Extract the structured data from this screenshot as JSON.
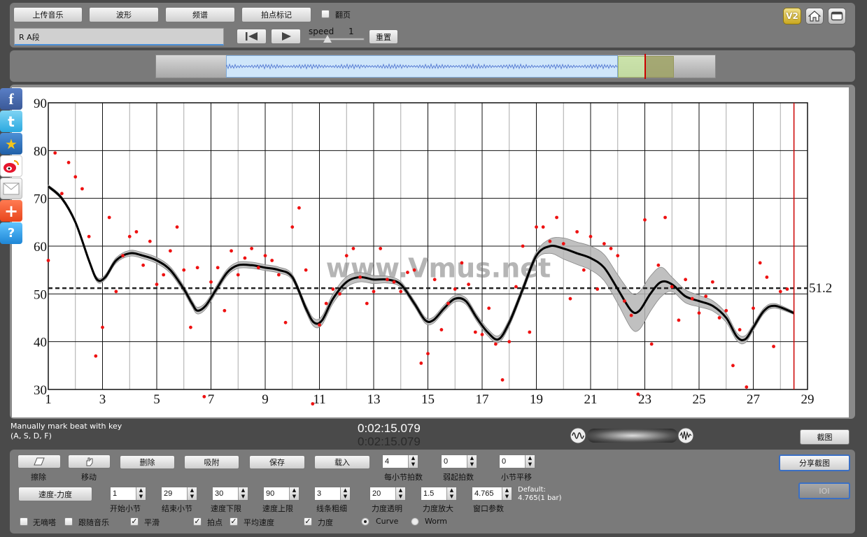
{
  "toolbar": {
    "upload_label": "上传音乐",
    "waveform_label": "波形",
    "spectrum_label": "频谱",
    "beat_mark_label": "拍点标记",
    "page_flip_label": "翻页",
    "page_flip_checked": false,
    "track_name": "R A段",
    "speed_label": "speed",
    "speed_value": "1",
    "reset_label": "重置",
    "version_label": "V2"
  },
  "chart_data": {
    "type": "scatter",
    "title": "",
    "xlabel": "",
    "ylabel": "",
    "xlim": [
      1,
      29
    ],
    "ylim": [
      30,
      90
    ],
    "x_ticks": [
      "1",
      "3",
      "5",
      "7",
      "9",
      "11",
      "13",
      "15",
      "17",
      "19",
      "21",
      "23",
      "25",
      "27",
      "29"
    ],
    "y_ticks": [
      "30",
      "40",
      "50",
      "60",
      "70",
      "80",
      "90"
    ],
    "average_label": "51.2",
    "average_value": 51.2,
    "cursor_x": 28.5,
    "watermark": "www.Vmus.net",
    "curve": [
      [
        1,
        72.5
      ],
      [
        1.5,
        70
      ],
      [
        2,
        65
      ],
      [
        2.5,
        57
      ],
      [
        2.8,
        53
      ],
      [
        3.1,
        53.5
      ],
      [
        3.5,
        57
      ],
      [
        4,
        58.5
      ],
      [
        4.5,
        58
      ],
      [
        5,
        57
      ],
      [
        5.5,
        55
      ],
      [
        6,
        51
      ],
      [
        6.3,
        48
      ],
      [
        6.5,
        46.5
      ],
      [
        6.8,
        47.5
      ],
      [
        7.2,
        51
      ],
      [
        7.6,
        54.5
      ],
      [
        8,
        56
      ],
      [
        8.5,
        56
      ],
      [
        9,
        55.5
      ],
      [
        9.5,
        55
      ],
      [
        10,
        53.5
      ],
      [
        10.5,
        47
      ],
      [
        10.8,
        44
      ],
      [
        11.1,
        44.5
      ],
      [
        11.5,
        49
      ],
      [
        12,
        52.5
      ],
      [
        12.5,
        53.5
      ],
      [
        13,
        53
      ],
      [
        13.5,
        53
      ],
      [
        14,
        52
      ],
      [
        14.5,
        48
      ],
      [
        14.9,
        44.5
      ],
      [
        15.2,
        44.5
      ],
      [
        15.6,
        47
      ],
      [
        16,
        49
      ],
      [
        16.4,
        48.5
      ],
      [
        16.8,
        45
      ],
      [
        17.2,
        42
      ],
      [
        17.6,
        40.5
      ],
      [
        18,
        44
      ],
      [
        18.5,
        51
      ],
      [
        19,
        58
      ],
      [
        19.5,
        60
      ],
      [
        20,
        59.5
      ],
      [
        20.5,
        58.5
      ],
      [
        21,
        57.5
      ],
      [
        21.5,
        55.5
      ],
      [
        22,
        51
      ],
      [
        22.5,
        46.5
      ],
      [
        22.8,
        46.5
      ],
      [
        23.2,
        50
      ],
      [
        23.6,
        52.5
      ],
      [
        24,
        52
      ],
      [
        24.5,
        49.5
      ],
      [
        25,
        48.5
      ],
      [
        25.5,
        47.5
      ],
      [
        26,
        45
      ],
      [
        26.4,
        41
      ],
      [
        26.7,
        40.5
      ],
      [
        27,
        43
      ],
      [
        27.4,
        46.5
      ],
      [
        27.8,
        47.5
      ],
      [
        28.5,
        46
      ]
    ],
    "band": [
      [
        1,
        0.3
      ],
      [
        4,
        0.6
      ],
      [
        6.5,
        0.7
      ],
      [
        10,
        0.6
      ],
      [
        11,
        0.9
      ],
      [
        12,
        1.1
      ],
      [
        14,
        0.6
      ],
      [
        19,
        0.8
      ],
      [
        20,
        2.2
      ],
      [
        21,
        2.5
      ],
      [
        22,
        3.0
      ],
      [
        22.7,
        4.0
      ],
      [
        23.5,
        3.5
      ],
      [
        24,
        1.5
      ],
      [
        26.5,
        0.8
      ],
      [
        28.5,
        0.3
      ]
    ],
    "points": [
      [
        1,
        57
      ],
      [
        1.25,
        79.5
      ],
      [
        1.5,
        71
      ],
      [
        1.75,
        77.5
      ],
      [
        2,
        74.5
      ],
      [
        2.25,
        72
      ],
      [
        2.5,
        62
      ],
      [
        2.75,
        37
      ],
      [
        3,
        43
      ],
      [
        3.25,
        66
      ],
      [
        3.5,
        50.5
      ],
      [
        3.75,
        58
      ],
      [
        4,
        62
      ],
      [
        4.25,
        63
      ],
      [
        4.5,
        56
      ],
      [
        4.75,
        61
      ],
      [
        5,
        52
      ],
      [
        5.25,
        54
      ],
      [
        5.5,
        59
      ],
      [
        5.75,
        64
      ],
      [
        6,
        55
      ],
      [
        6.25,
        43
      ],
      [
        6.5,
        55.5
      ],
      [
        6.75,
        28.5
      ],
      [
        7,
        52.5
      ],
      [
        7.25,
        55.5
      ],
      [
        7.5,
        46.5
      ],
      [
        7.75,
        59
      ],
      [
        8,
        54
      ],
      [
        8.25,
        57.5
      ],
      [
        8.5,
        59.5
      ],
      [
        8.75,
        55.5
      ],
      [
        9,
        58
      ],
      [
        9.25,
        57
      ],
      [
        9.5,
        54
      ],
      [
        9.75,
        44
      ],
      [
        10,
        64
      ],
      [
        10.25,
        68
      ],
      [
        10.5,
        55
      ],
      [
        10.75,
        27
      ],
      [
        11,
        43.5
      ],
      [
        11.25,
        48
      ],
      [
        11.5,
        51
      ],
      [
        11.75,
        50
      ],
      [
        12,
        58
      ],
      [
        12.25,
        59.5
      ],
      [
        12.5,
        53.5
      ],
      [
        12.75,
        48
      ],
      [
        13,
        50.5
      ],
      [
        13.25,
        59.5
      ],
      [
        13.5,
        53
      ],
      [
        13.75,
        52.5
      ],
      [
        14,
        50.5
      ],
      [
        14.25,
        54.5
      ],
      [
        14.5,
        55
      ],
      [
        14.75,
        35.5
      ],
      [
        15,
        37.5
      ],
      [
        15.25,
        53
      ],
      [
        15.5,
        42.5
      ],
      [
        15.75,
        48
      ],
      [
        16,
        51
      ],
      [
        16.25,
        56.5
      ],
      [
        16.5,
        52
      ],
      [
        16.75,
        42
      ],
      [
        17,
        41.5
      ],
      [
        17.25,
        47
      ],
      [
        17.5,
        39.5
      ],
      [
        17.75,
        32
      ],
      [
        18,
        40
      ],
      [
        18.25,
        51.5
      ],
      [
        18.5,
        60
      ],
      [
        18.75,
        42
      ],
      [
        19,
        64
      ],
      [
        19.25,
        64
      ],
      [
        19.5,
        61
      ],
      [
        19.75,
        66
      ],
      [
        20,
        60.5
      ],
      [
        20.25,
        49
      ],
      [
        20.5,
        63
      ],
      [
        20.75,
        55
      ],
      [
        21,
        62
      ],
      [
        21.25,
        51
      ],
      [
        21.5,
        60.5
      ],
      [
        21.75,
        59.5
      ],
      [
        22,
        58
      ],
      [
        22.25,
        48.5
      ],
      [
        22.5,
        45.5
      ],
      [
        22.75,
        29
      ],
      [
        23,
        65.5
      ],
      [
        23.25,
        39.5
      ],
      [
        23.5,
        56
      ],
      [
        23.75,
        66
      ],
      [
        24,
        51.5
      ],
      [
        24.25,
        44.5
      ],
      [
        24.5,
        53
      ],
      [
        24.75,
        49
      ],
      [
        25,
        46
      ],
      [
        25.25,
        49.5
      ],
      [
        25.5,
        52.5
      ],
      [
        25.75,
        45
      ],
      [
        26,
        46.5
      ],
      [
        26.25,
        35
      ],
      [
        26.5,
        42.5
      ],
      [
        26.75,
        30.5
      ],
      [
        27,
        47
      ],
      [
        27.25,
        56.5
      ],
      [
        27.5,
        53.5
      ],
      [
        27.75,
        39
      ],
      [
        28,
        50.5
      ],
      [
        28.25,
        51
      ]
    ]
  },
  "status": {
    "hint_line1": "Manually mark beat with key",
    "hint_line2": "(A, S, D, F)",
    "time_primary": "0:02:15.079",
    "time_secondary": "0:02:15.079",
    "screenshot_label": "截图"
  },
  "controls": {
    "erase_label": "擦除",
    "move_label": "移动",
    "delete_label": "删除",
    "snap_label": "吸附",
    "save_label": "保存",
    "load_label": "载入",
    "mode_label": "速度-力度",
    "share_label": "分享截图",
    "ioi_label": "IOI",
    "beats_per_bar": {
      "value": "4",
      "caption": "每小节拍数"
    },
    "pickup_beats": {
      "value": "0",
      "caption": "弱起拍数"
    },
    "bar_shift": {
      "value": "0",
      "caption": "小节平移"
    },
    "start_bar": {
      "value": "1",
      "caption": "开始小节"
    },
    "end_bar": {
      "value": "29",
      "caption": "结束小节"
    },
    "tempo_min": {
      "value": "30",
      "caption": "速度下限"
    },
    "tempo_max": {
      "value": "90",
      "caption": "速度上限"
    },
    "line_width": {
      "value": "3",
      "caption": "线条粗细"
    },
    "dynamics_alpha": {
      "value": "20",
      "caption": "力度透明"
    },
    "dynamics_scale": {
      "value": "1.5",
      "caption": "力度放大"
    },
    "window_param": {
      "value": "4.765",
      "caption": "窗口参数"
    },
    "default_line1": "Default:",
    "default_line2": "4.765(1 bar)",
    "no_click": {
      "label": "无嘀嗒",
      "checked": false
    },
    "follow_music": {
      "label": "跟随音乐",
      "checked": false
    },
    "smooth": {
      "label": "平滑",
      "checked": true
    },
    "beat_points": {
      "label": "拍点",
      "checked": true
    },
    "avg_tempo": {
      "label": "平均速度",
      "checked": true
    },
    "dynamics": {
      "label": "力度",
      "checked": true
    },
    "curve_mode": "Curve",
    "worm_mode": "Worm"
  },
  "colors": {
    "panel": "#7a7a7a",
    "curve": "#000000",
    "points": "#ee1111",
    "band": "#b5b5b5",
    "cursor": "#cc0000",
    "selection": "#cfe6fa",
    "wave": "#5b7fd4"
  }
}
